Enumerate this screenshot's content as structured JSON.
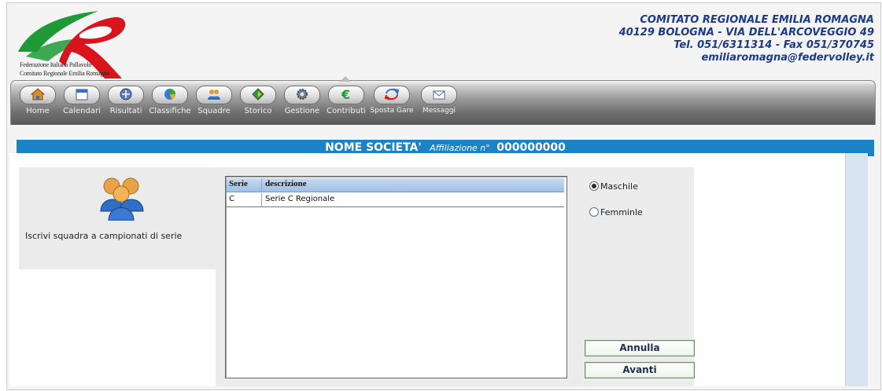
{
  "logo": {
    "line1": "Federazione Italiana Pallavolo",
    "line2": "Comitato Regionale Emilia Romagna",
    "colors": {
      "green": "#1f9a36",
      "red": "#d8141c",
      "blue": "#1d3a86"
    }
  },
  "header": {
    "org_lines": [
      "COMITATO REGIONALE EMILIA ROMAGNA",
      "40129 BOLOGNA - VIA DELL'ARCOVEGGIO 49",
      "Tel. 051/6311314 - Fax 051/370745",
      "emiliaromagna@federvolley.it"
    ]
  },
  "nav": {
    "items": [
      {
        "label": "Home",
        "icon": "home-icon"
      },
      {
        "label": "Calendari",
        "icon": "calendar-icon"
      },
      {
        "label": "Risultati",
        "icon": "results-icon"
      },
      {
        "label": "Classifiche",
        "icon": "standings-icon"
      },
      {
        "label": "Squadre",
        "icon": "teams-icon"
      },
      {
        "label": "Storico",
        "icon": "history-icon"
      },
      {
        "label": "Gestione",
        "icon": "gear-icon"
      },
      {
        "label": "Contributi",
        "icon": "euro-icon"
      },
      {
        "label": "Sposta Gare",
        "icon": "move-games-icon"
      },
      {
        "label": "Messaggi",
        "icon": "envelope-icon"
      }
    ],
    "active": "Gestione"
  },
  "titlebar": {
    "societa": "NOME SOCIETA'",
    "affiliazione_label": "Affiliazione n°",
    "affiliazione_code": "000000000",
    "color": "#1b82c6"
  },
  "left_panel": {
    "icon": "users-group-icon",
    "label": "Iscrivi squadra a campionati di serie"
  },
  "table": {
    "columns": [
      "Serie",
      "descrizione"
    ],
    "rows": [
      [
        "C",
        "Serie C Regionale"
      ]
    ]
  },
  "gender": {
    "options": [
      "Maschile",
      "Femminle"
    ],
    "selected": "Maschile"
  },
  "buttons": {
    "cancel": "Annulla",
    "next": "Avanti"
  }
}
